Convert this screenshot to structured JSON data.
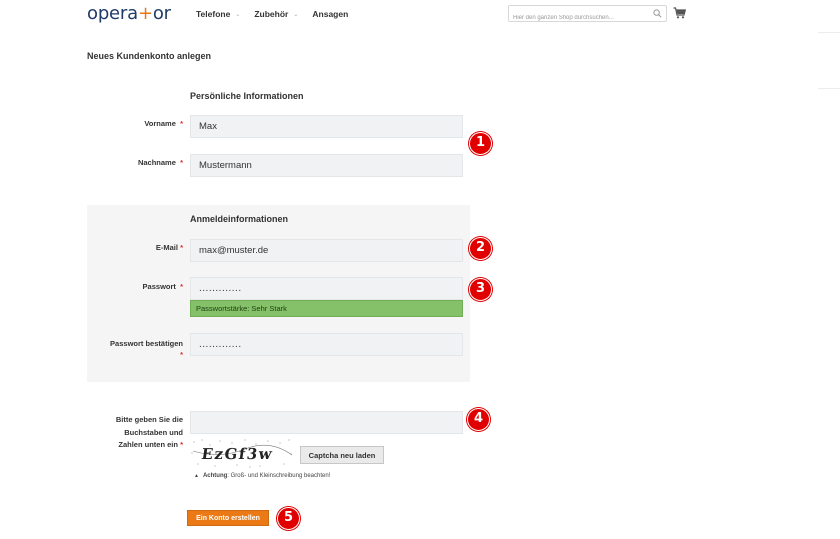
{
  "header": {
    "logo_part1": "opera",
    "logo_plus": "+",
    "logo_part2": "or",
    "nav": [
      {
        "label": "Telefone",
        "caret": "⌄"
      },
      {
        "label": "Zubehör",
        "caret": "⌄"
      },
      {
        "label": "Ansagen"
      }
    ],
    "search_placeholder": "Hier den ganzen Shop durchsuchen..."
  },
  "page_title": "Neues Kundenkonto anlegen",
  "personal": {
    "title": "Persönliche Informationen",
    "firstname_label": "Vorname",
    "firstname_value": "Max",
    "lastname_label": "Nachname",
    "lastname_value": "Mustermann"
  },
  "login": {
    "title": "Anmeldeinformationen",
    "email_label": "E-Mail",
    "email_value": "max@muster.de",
    "password_label": "Passwort",
    "password_value": ".............",
    "strength_text": "Passwortstärke: Sehr Stark",
    "confirm_label": "Passwort bestätigen",
    "confirm_value": "............."
  },
  "captcha": {
    "label_line1": "Bitte geben Sie die",
    "label_line2": "Buchstaben und",
    "label_line3": "Zahlen unten ein",
    "value": "",
    "image_text": "EzGf3w",
    "reload_label": "Captcha neu laden",
    "note_title": "Achtung",
    "note_text": ": Groß- und Kleinschreibung beachten!"
  },
  "required_marker": "*",
  "submit_label": "Ein Konto erstellen",
  "badges": [
    "1",
    "2",
    "3",
    "4",
    "5"
  ],
  "colors": {
    "accent": "#eb7a16",
    "brand": "#1f3b68",
    "required": "#e02b27",
    "badge": "#e00000",
    "strength": "#84c169"
  }
}
